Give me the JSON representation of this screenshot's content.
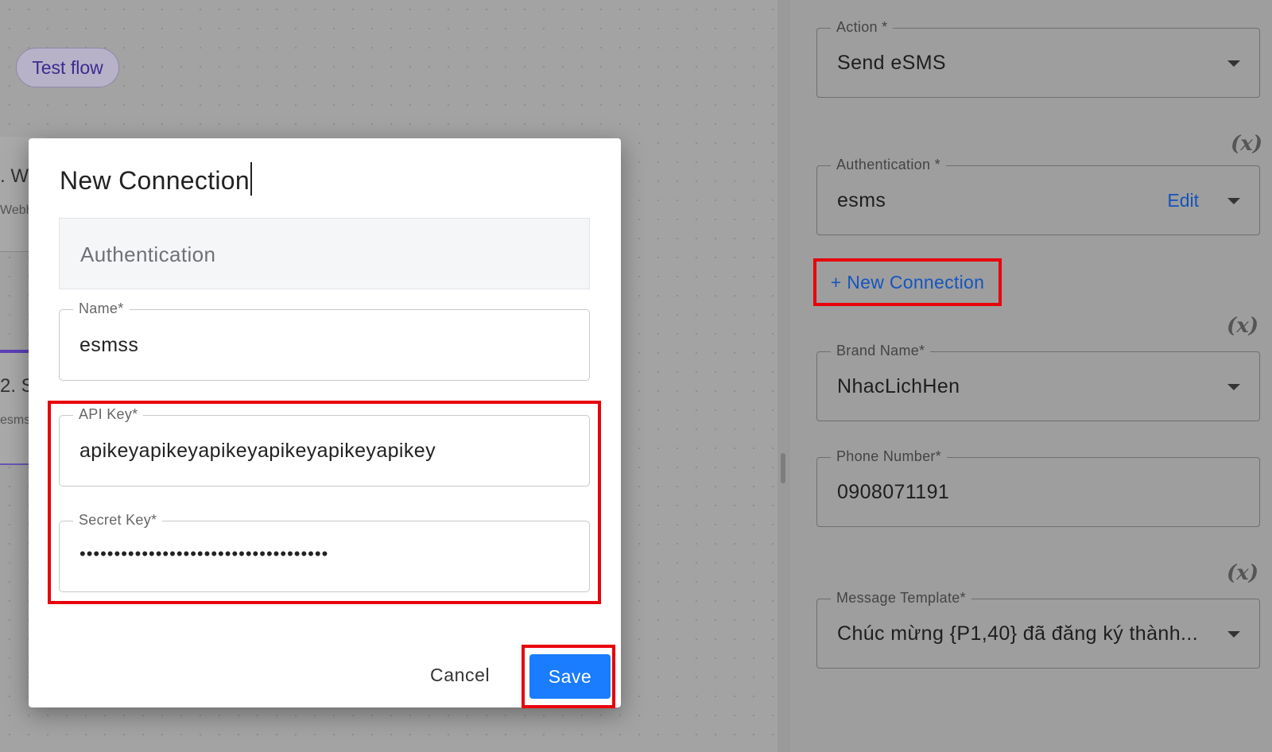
{
  "canvas": {
    "test_flow_label": "Test flow",
    "node1": {
      "title": ". W",
      "subtitle": "Webh"
    },
    "node2": {
      "title": "2. S",
      "subtitle": "esms"
    }
  },
  "panel": {
    "action": {
      "label": "Action *",
      "value": "Send eSMS"
    },
    "authentication": {
      "label": "Authentication *",
      "value": "esms",
      "edit_label": "Edit"
    },
    "new_connection_label": "+ New Connection",
    "variable_icon": "(x)",
    "brand_name": {
      "label": "Brand Name*",
      "value": "NhacLichHen"
    },
    "phone_number": {
      "label": "Phone Number*",
      "value": "0908071191"
    },
    "message_template": {
      "label": "Message Template*",
      "value": "Chúc mừng {P1,40} đã đăng ký thành..."
    }
  },
  "modal": {
    "title": "New Connection",
    "auth_section_label": "Authentication",
    "name": {
      "label": "Name*",
      "value": "esmss"
    },
    "api_key": {
      "label": "API Key*",
      "value": "apikeyapikeyapikeyapikeyapikeyapikey"
    },
    "secret_key": {
      "label": "Secret Key*",
      "value": "••••••••••••••••••••••••••••••••••••"
    },
    "cancel_label": "Cancel",
    "save_label": "Save"
  },
  "colors": {
    "accent": "#1a7cff",
    "link": "#1555bf",
    "highlight": "#e8000b",
    "flow_purple": "#5b3fb8"
  }
}
